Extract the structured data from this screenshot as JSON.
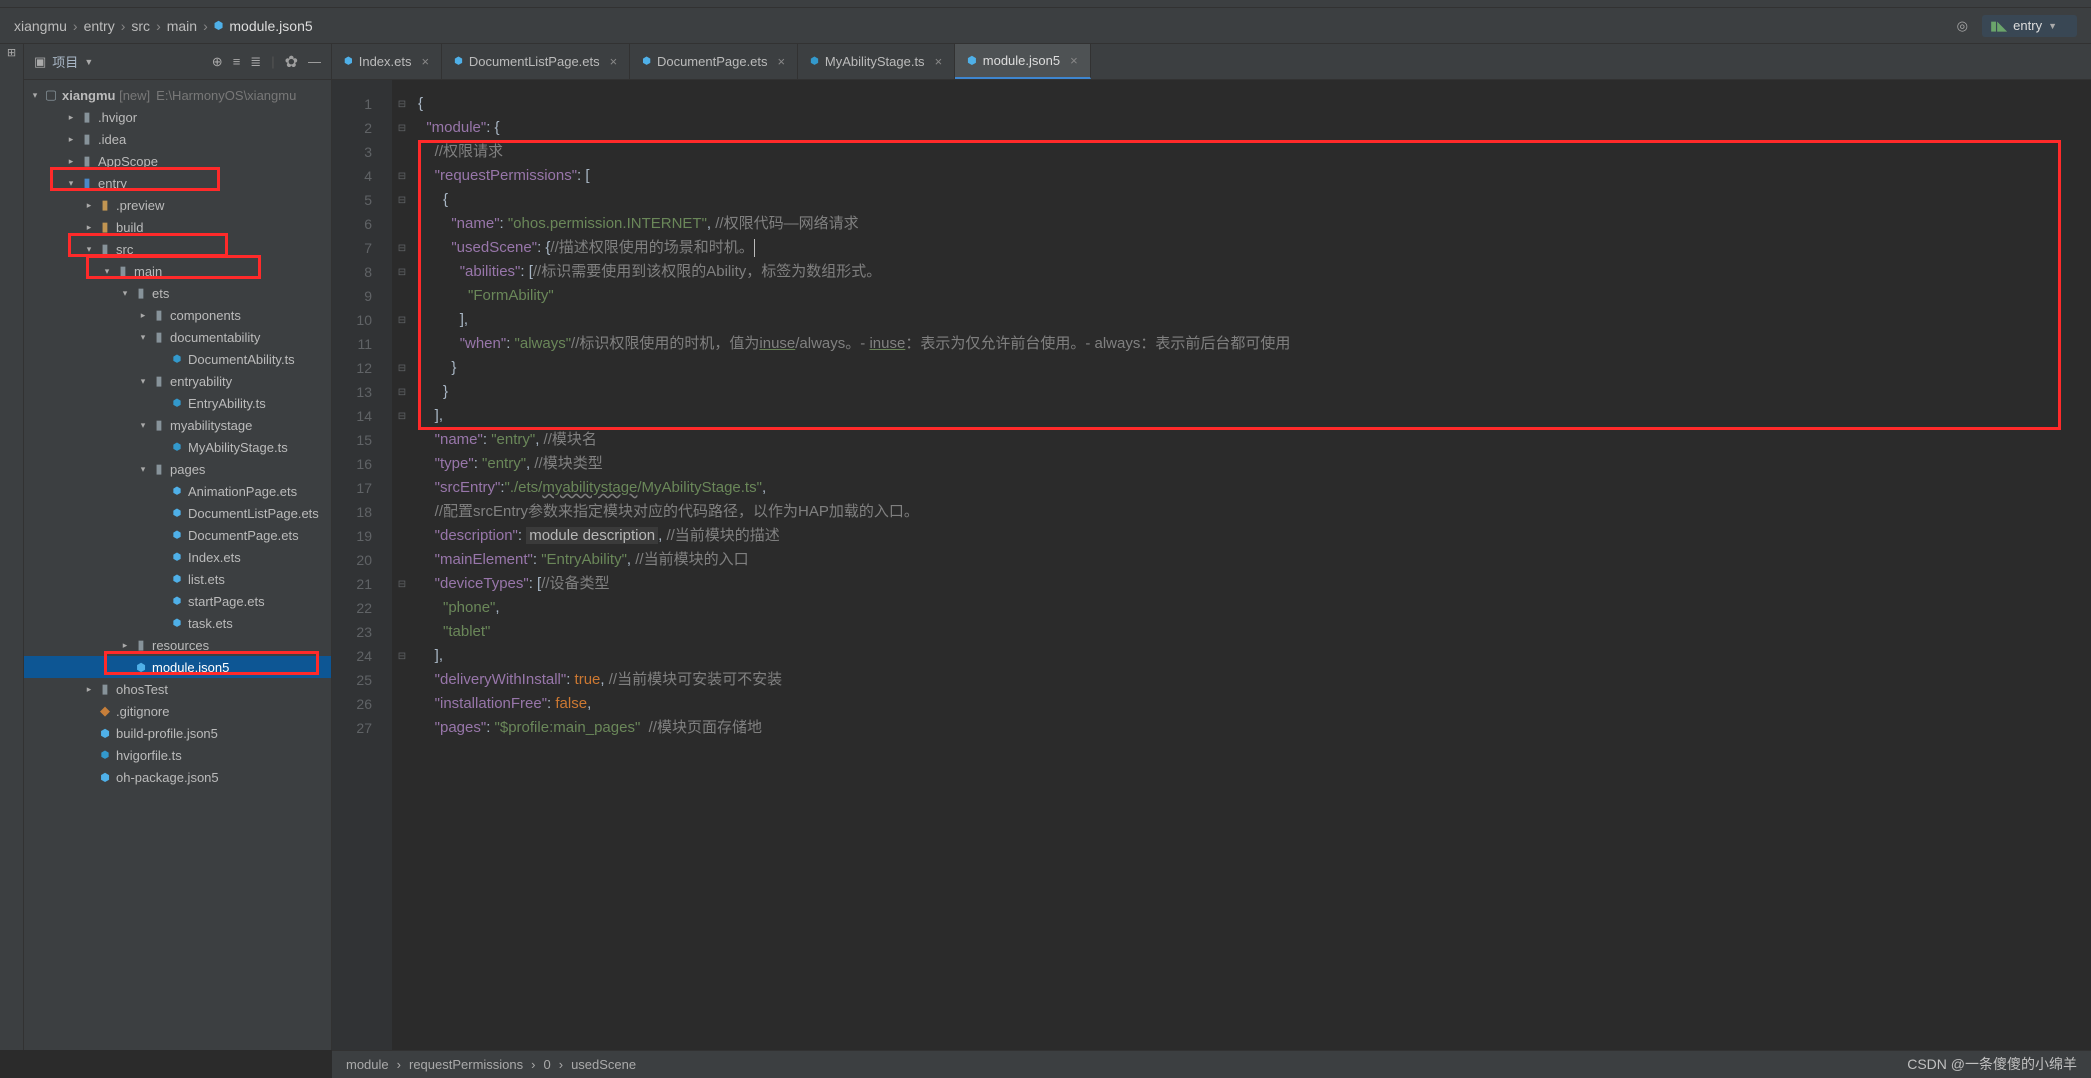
{
  "breadcrumb": [
    "xiangmu",
    "entry",
    "src",
    "main",
    "module.json5"
  ],
  "run_config": "entry",
  "project_label": "项目",
  "tree": {
    "root": {
      "name": "xiangmu",
      "tag": "[new]",
      "path": "E:\\HarmonyOS\\xiangmu"
    },
    "items": [
      {
        "d": 2,
        "t": "folder",
        "name": ".hvigor",
        "exp": false
      },
      {
        "d": 2,
        "t": "folder",
        "name": ".idea",
        "exp": false
      },
      {
        "d": 2,
        "t": "folder",
        "name": "AppScope",
        "exp": false
      },
      {
        "d": 2,
        "t": "folder-blue",
        "name": "entry",
        "exp": true,
        "red": true
      },
      {
        "d": 3,
        "t": "folder-orange",
        "name": ".preview",
        "exp": false
      },
      {
        "d": 3,
        "t": "folder-orange",
        "name": "build",
        "exp": false
      },
      {
        "d": 3,
        "t": "folder",
        "name": "src",
        "exp": true,
        "red": true
      },
      {
        "d": 4,
        "t": "folder",
        "name": "main",
        "exp": true,
        "red": true
      },
      {
        "d": 5,
        "t": "folder",
        "name": "ets",
        "exp": true
      },
      {
        "d": 6,
        "t": "folder",
        "name": "components",
        "exp": false
      },
      {
        "d": 6,
        "t": "folder",
        "name": "documentability",
        "exp": true
      },
      {
        "d": 7,
        "t": "file-ts",
        "name": "DocumentAbility.ts"
      },
      {
        "d": 6,
        "t": "folder",
        "name": "entryability",
        "exp": true
      },
      {
        "d": 7,
        "t": "file-ts",
        "name": "EntryAbility.ts"
      },
      {
        "d": 6,
        "t": "folder",
        "name": "myabilitystage",
        "exp": true
      },
      {
        "d": 7,
        "t": "file-ts",
        "name": "MyAbilityStage.ts"
      },
      {
        "d": 6,
        "t": "folder",
        "name": "pages",
        "exp": true
      },
      {
        "d": 7,
        "t": "file-ets",
        "name": "AnimationPage.ets"
      },
      {
        "d": 7,
        "t": "file-ets",
        "name": "DocumentListPage.ets"
      },
      {
        "d": 7,
        "t": "file-ets",
        "name": "DocumentPage.ets"
      },
      {
        "d": 7,
        "t": "file-ets",
        "name": "Index.ets"
      },
      {
        "d": 7,
        "t": "file-ets",
        "name": "list.ets"
      },
      {
        "d": 7,
        "t": "file-ets",
        "name": "startPage.ets"
      },
      {
        "d": 7,
        "t": "file-ets",
        "name": "task.ets"
      },
      {
        "d": 5,
        "t": "folder",
        "name": "resources",
        "exp": false,
        "redline": true
      },
      {
        "d": 5,
        "t": "file-json",
        "name": "module.json5",
        "selected": true,
        "red": true
      },
      {
        "d": 3,
        "t": "folder",
        "name": "ohosTest",
        "exp": false
      },
      {
        "d": 3,
        "t": "file-git",
        "name": ".gitignore"
      },
      {
        "d": 3,
        "t": "file-json",
        "name": "build-profile.json5"
      },
      {
        "d": 3,
        "t": "file-ts",
        "name": "hvigorfile.ts"
      },
      {
        "d": 3,
        "t": "file-json",
        "name": "oh-package.json5"
      }
    ]
  },
  "tabs": [
    {
      "name": "Index.ets",
      "icon": "ets"
    },
    {
      "name": "DocumentListPage.ets",
      "icon": "ets"
    },
    {
      "name": "DocumentPage.ets",
      "icon": "ets"
    },
    {
      "name": "MyAbilityStage.ts",
      "icon": "ts"
    },
    {
      "name": "module.json5",
      "icon": "json",
      "active": true
    }
  ],
  "code": {
    "lines": 27,
    "c1": "//权限请求",
    "c2": "//权限代码—网络请求",
    "c3": "//描述权限使用的场景和时机。",
    "c4": "//标识需要使用到该权限的Ability，标签为数组形式。",
    "c5": "//标识权限使用的时机，值为",
    "c5b": "。- ",
    "c5c": "：表示为仅允许前台使用。- ",
    "c5d": "：表示前后台都可使用",
    "c6": "//模块名",
    "c7": "//模块类型",
    "c8": "//配置srcEntry参数来指定模块对应的代码路径，以作为HAP加载的入口。",
    "c9": "//当前模块的描述",
    "c10": "//当前模块的入口",
    "c11": "//设备类型",
    "c12": "//当前模块可安装可不安装",
    "c13": "//模块页面存储地",
    "k_module": "\"module\"",
    "k_requestPermissions": "\"requestPermissions\"",
    "k_name": "\"name\"",
    "k_usedScene": "\"usedScene\"",
    "k_abilities": "\"abilities\"",
    "k_when": "\"when\"",
    "k_type": "\"type\"",
    "k_srcEntry": "\"srcEntry\"",
    "k_description": "\"description\"",
    "k_mainElement": "\"mainElement\"",
    "k_deviceTypes": "\"deviceTypes\"",
    "k_deliveryWithInstall": "\"deliveryWithInstall\"",
    "k_installationFree": "\"installationFree\"",
    "k_pages": "\"pages\"",
    "v_internet": "\"ohos.permission.INTERNET\"",
    "v_FormAbility": "\"FormAbility\"",
    "v_always": "\"always\"",
    "v_entry": "\"entry\"",
    "v_srcEntry_a": "\"./ets/",
    "v_srcEntry_b": "myabilitystage",
    "v_srcEntry_c": "/MyAbilityStage.ts\"",
    "v_module_description": "module description",
    "v_EntryAbility": "\"EntryAbility\"",
    "v_phone": "\"phone\"",
    "v_tablet": "\"tablet\"",
    "v_mainpages": "\"$profile:main_pages\"",
    "v_true": "true",
    "v_false": "false",
    "inuse": "inuse",
    "always": "always"
  },
  "statusbar": [
    "module",
    "requestPermissions",
    "0",
    "usedScene"
  ],
  "watermark": "CSDN @一条傻傻的小绵羊"
}
